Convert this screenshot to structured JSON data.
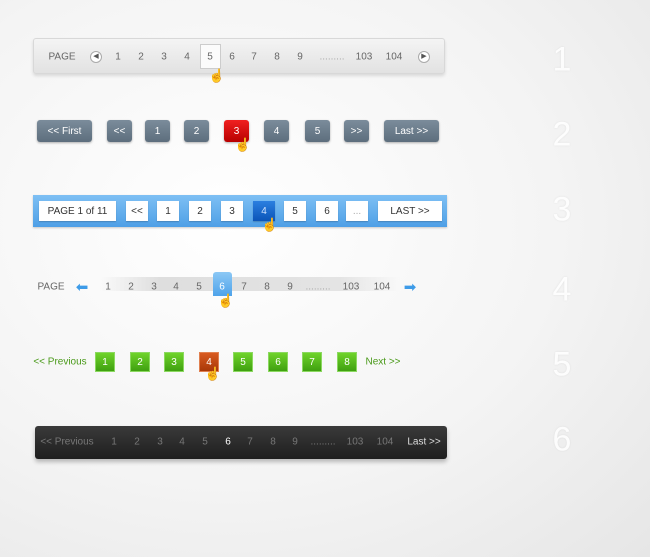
{
  "row1": {
    "label": "PAGE",
    "prev_icon": "circle-left-arrow",
    "next_icon": "circle-right-arrow",
    "pages": [
      "1",
      "2",
      "3",
      "4",
      "5",
      "6",
      "7",
      "8",
      "9",
      ".........",
      "103",
      "104"
    ],
    "active": "5"
  },
  "row2": {
    "items": [
      "<< First",
      "<<",
      "1",
      "2",
      "3",
      "4",
      "5",
      ">>",
      "Last >>"
    ],
    "active": "3",
    "color": "#6a7b8a",
    "active_color": "#d40000"
  },
  "row3": {
    "items": [
      "PAGE 1 of 11",
      "<<",
      "1",
      "2",
      "3",
      "4",
      "5",
      "6",
      "...",
      "LAST >>"
    ],
    "active": "4",
    "color": "#5aaaf0"
  },
  "row4": {
    "label": "PAGE",
    "prev_icon": "blue-left-arrow",
    "next_icon": "blue-right-arrow",
    "pages": [
      "1",
      "2",
      "3",
      "4",
      "5",
      "6",
      "7",
      "8",
      "9",
      ".........",
      "103",
      "104"
    ],
    "active": "6"
  },
  "row5": {
    "prev": "<< Previous",
    "next": "Next >>",
    "pages": [
      "1",
      "2",
      "3",
      "4",
      "5",
      "6",
      "7",
      "8"
    ],
    "active": "4",
    "color": "#4caf18",
    "active_color": "#c84a14"
  },
  "row6": {
    "prev": "<< Previous",
    "next": "Last >>",
    "pages": [
      "1",
      "2",
      "3",
      "4",
      "5",
      "6",
      "7",
      "8",
      "9",
      ".........",
      "103",
      "104"
    ],
    "active": "6"
  },
  "labels": [
    "1",
    "2",
    "3",
    "4",
    "5",
    "6"
  ]
}
